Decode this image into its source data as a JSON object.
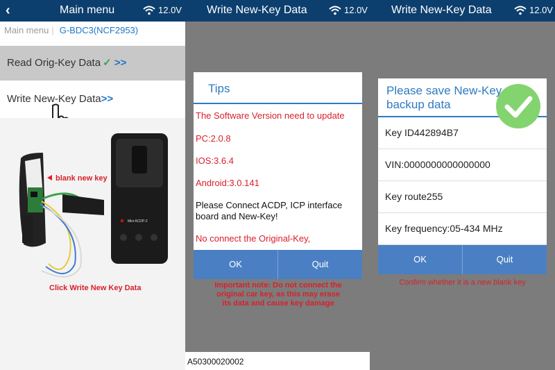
{
  "status": {
    "battery": "12.0V"
  },
  "panel1": {
    "title": "Main menu",
    "breadcrumb_root": "Main menu",
    "breadcrumb_sep": "|",
    "model": "G-BDC3(NCF2953)",
    "menu": [
      {
        "label": "Read Orig-Key Data",
        "check": "✓",
        "chevron": ">>"
      },
      {
        "label": "Write New-Key Data",
        "chevron": ">>"
      }
    ],
    "callout": "blank new key",
    "caption": "Click Write New Key Data",
    "device_label": "Mini ACDP-2"
  },
  "panel2": {
    "title": "Write New-Key Data",
    "dialog_title": "Tips",
    "messages": [
      "The Software Version need to update",
      "PC:2.0.8",
      "IOS:3.6.4",
      "Android:3.0.141",
      "Please Connect ACDP, ICP interface board and New-Key!",
      "No connect the Original-Key,"
    ],
    "ok": "OK",
    "quit": "Quit",
    "note": "Important note: Do not connect the original car key, as this may erase its data and cause key damage",
    "serial": "A50300020002"
  },
  "panel3": {
    "title": "Write New-Key Data",
    "dialog_title": "Please save New-Key backup data",
    "items": [
      "Key ID442894B7",
      "VIN:0000000000000000",
      "Key route255",
      "Key frequency:05-434 MHz"
    ],
    "ok": "OK",
    "quit": "Quit",
    "note": "Confirm whether it is a new blank key"
  },
  "colors": {
    "header": "#0d3f6e",
    "accent": "#2d7ac2",
    "button": "#4a80c3",
    "alert": "#d9202b",
    "success": "#83d46f"
  }
}
